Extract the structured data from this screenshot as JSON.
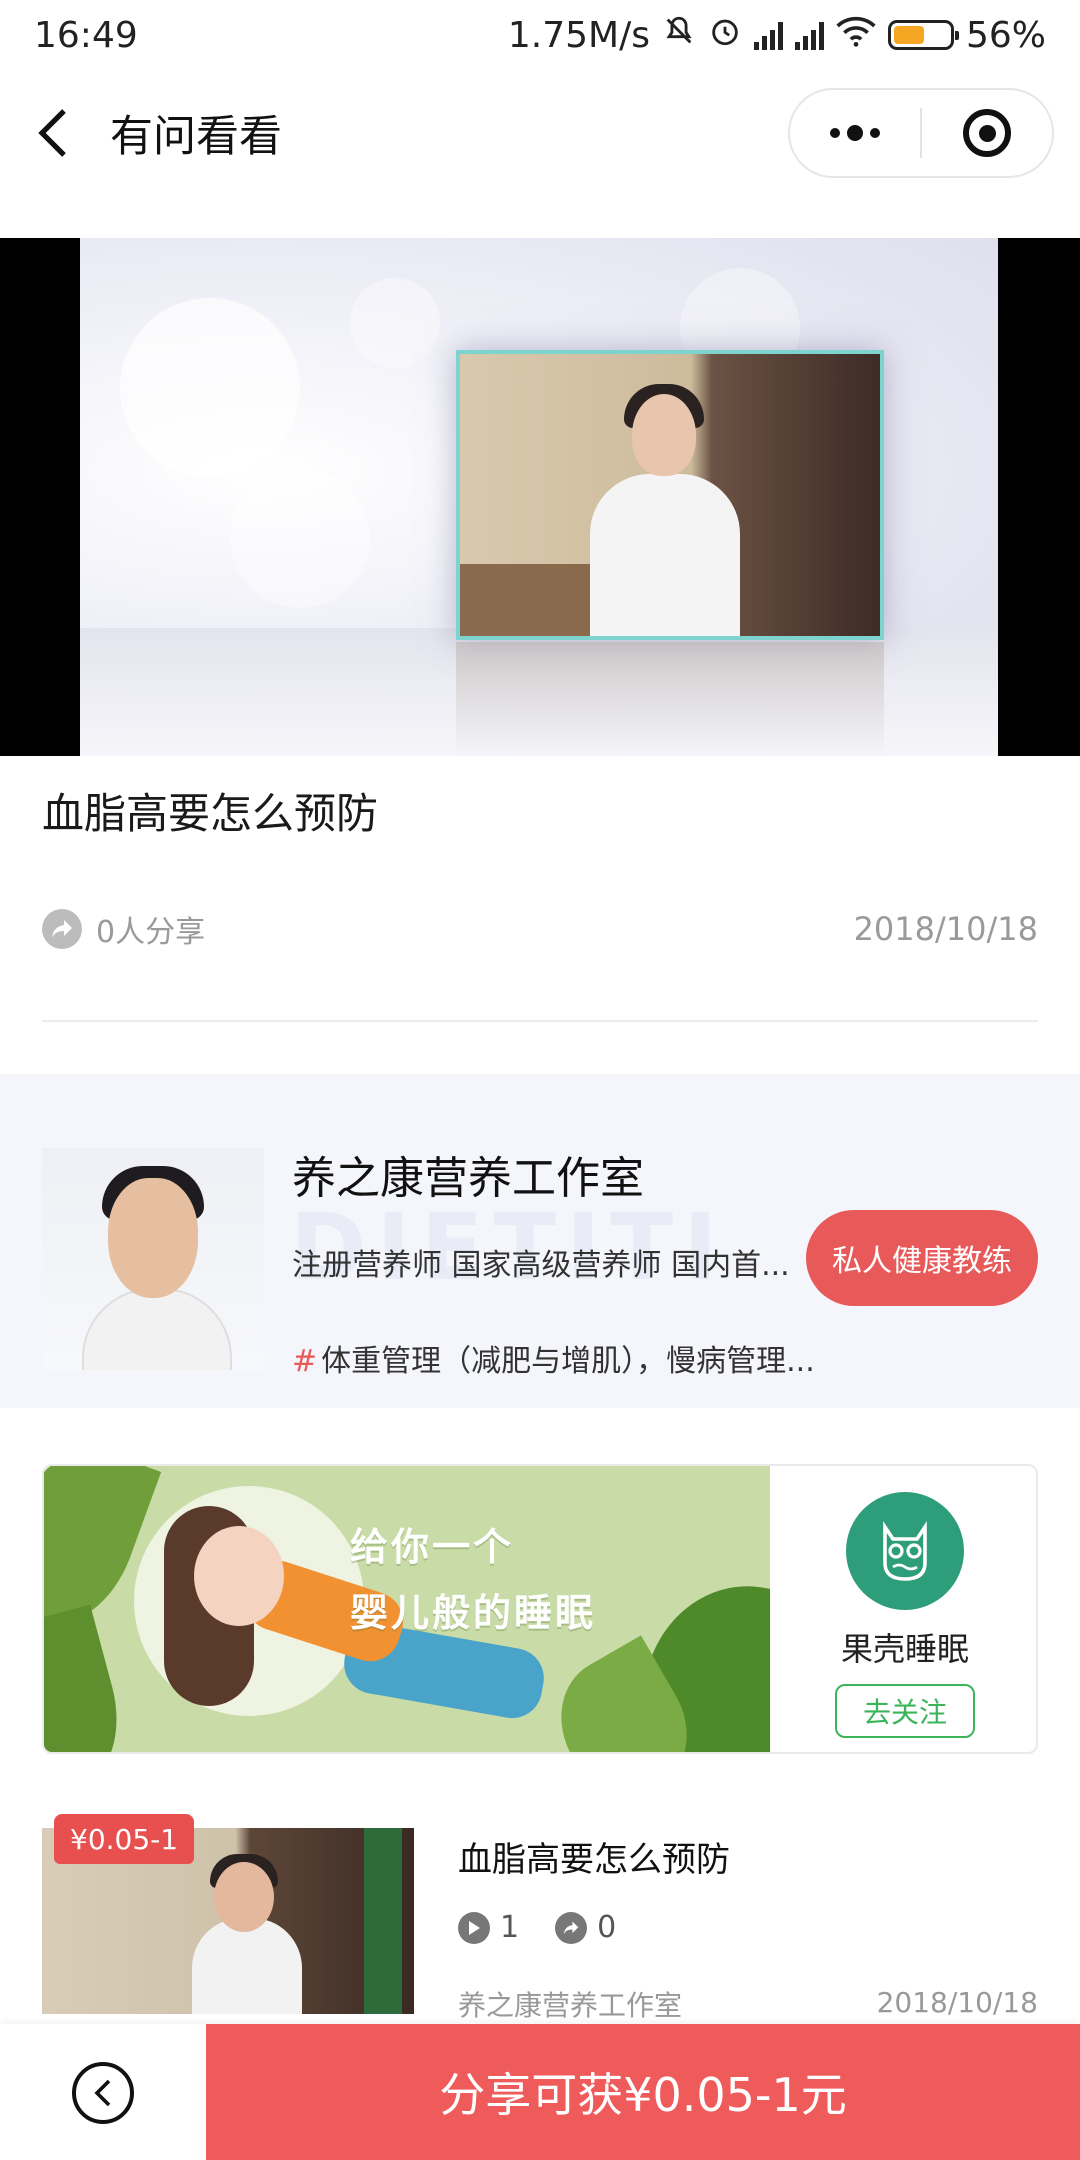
{
  "status_bar": {
    "time": "16:49",
    "speed": "1.75M/s",
    "battery": "56%",
    "battery_level": 0.56
  },
  "nav": {
    "title": "有问看看"
  },
  "article": {
    "title": "血脂高要怎么预防",
    "share_count": "0人分享",
    "date": "2018/10/18"
  },
  "studio": {
    "name": "养之康营养工作室",
    "description": "注册营养师 国家高级营养师 国内首...",
    "tags": "体重管理（减肥与增肌），慢病管理...",
    "tag_prefix": "#",
    "coach_button": "私人健康教练",
    "watermark": "DIETITI"
  },
  "ad": {
    "line1": "给你一个",
    "line2": "婴儿般的睡眠",
    "brand": "果壳睡眠",
    "follow_button": "去关注"
  },
  "list": [
    {
      "price_tag": "¥0.05-1",
      "title": "血脂高要怎么预防",
      "plays": "1",
      "shares": "0",
      "source": "养之康营养工作室",
      "date": "2018/10/18"
    }
  ],
  "bottom_bar": {
    "cta": "分享可获¥0.05-1元"
  },
  "colors": {
    "accent_red": "#ef5a5a",
    "follow_green": "#3cb55a",
    "studio_bg": "#f4f6fb"
  }
}
